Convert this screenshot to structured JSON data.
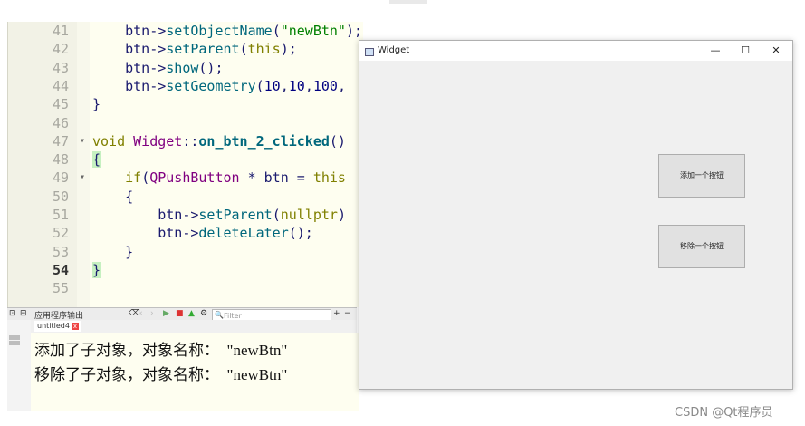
{
  "editor": {
    "lines": [
      {
        "n": "41",
        "segs": [
          [
            "    btn->",
            ""
          ],
          [
            "setObjectName",
            "fn"
          ],
          [
            "(",
            ""
          ],
          [
            "\"newBtn\"",
            "str"
          ],
          [
            ");",
            ""
          ]
        ]
      },
      {
        "n": "42",
        "segs": [
          [
            "    btn->",
            ""
          ],
          [
            "setParent",
            "fn"
          ],
          [
            "(",
            ""
          ],
          [
            "this",
            "kw"
          ],
          [
            ");",
            ""
          ]
        ]
      },
      {
        "n": "43",
        "segs": [
          [
            "    btn->",
            ""
          ],
          [
            "show",
            "fn"
          ],
          [
            "();",
            ""
          ]
        ]
      },
      {
        "n": "44",
        "segs": [
          [
            "    btn->",
            ""
          ],
          [
            "setGeometry",
            "fn"
          ],
          [
            "(",
            ""
          ],
          [
            "10",
            "num"
          ],
          [
            ",",
            ""
          ],
          [
            "10",
            "num"
          ],
          [
            ",",
            ""
          ],
          [
            "100",
            "num"
          ],
          [
            ",",
            ""
          ]
        ]
      },
      {
        "n": "45",
        "segs": [
          [
            "}",
            ""
          ]
        ]
      },
      {
        "n": "46",
        "segs": []
      },
      {
        "n": "47",
        "fold": "▾",
        "segs": [
          [
            "void ",
            "kw"
          ],
          [
            "Widget",
            "cls"
          ],
          [
            "::",
            ""
          ],
          [
            "on_btn_2_clicked",
            "fnb"
          ],
          [
            "()",
            ""
          ]
        ]
      },
      {
        "n": "48",
        "brace": true,
        "segs": [
          [
            "{",
            ""
          ]
        ]
      },
      {
        "n": "49",
        "fold": "▾",
        "segs": [
          [
            "    ",
            ""
          ],
          [
            "if",
            "kw"
          ],
          [
            "(",
            ""
          ],
          [
            "QPushButton",
            "cls"
          ],
          [
            " * btn = ",
            ""
          ],
          [
            "this",
            "kw"
          ]
        ]
      },
      {
        "n": "50",
        "segs": [
          [
            "    {",
            ""
          ]
        ]
      },
      {
        "n": "51",
        "segs": [
          [
            "        btn->",
            ""
          ],
          [
            "setParent",
            "fn"
          ],
          [
            "(",
            ""
          ],
          [
            "nullptr",
            "kw"
          ],
          [
            ")",
            ""
          ]
        ]
      },
      {
        "n": "52",
        "segs": [
          [
            "        btn->",
            ""
          ],
          [
            "deleteLater",
            "fn"
          ],
          [
            "();",
            ""
          ]
        ]
      },
      {
        "n": "53",
        "segs": [
          [
            "    }",
            ""
          ]
        ]
      },
      {
        "n": "54",
        "brace": true,
        "current": true,
        "segs": [
          [
            "}",
            ""
          ]
        ]
      },
      {
        "n": "55",
        "segs": []
      }
    ]
  },
  "panel": {
    "title": "应用程序输出",
    "filter_placeholder": "Filter",
    "tab_label": "untitled4",
    "tab_close": "x",
    "output_lines": [
      "添加了子对象，对象名称：  \"newBtn\"",
      "移除了子对象，对象名称：  \"newBtn\""
    ]
  },
  "widget_window": {
    "title": "Widget",
    "minimize": "—",
    "maximize": "☐",
    "close": "✕",
    "add_button": "添加一个按钮",
    "remove_button": "移除一个按钮"
  },
  "watermark": "CSDN @Qt程序员"
}
